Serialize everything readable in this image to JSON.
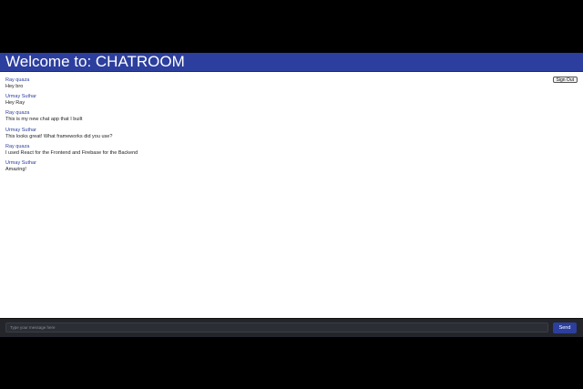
{
  "header": {
    "title": "Welcome to: CHATROOM",
    "background": "#2c3e9e"
  },
  "toolbar": {
    "sign_out_label": "Sign Out"
  },
  "messages": [
    {
      "author": "Ray quaza",
      "text": "Hey bro"
    },
    {
      "author": "Urmay Suthar",
      "text": "Hey Ray"
    },
    {
      "author": "Ray quaza",
      "text": "This is my new chat app that I built"
    },
    {
      "author": "Urmay Suthar",
      "text": "This looks great! What frameworks did you use?"
    },
    {
      "author": "Ray quaza",
      "text": "I used React for the Frontend and Firebase for the Backend"
    },
    {
      "author": "Urmay Suthar",
      "text": "Amazing!"
    }
  ],
  "composer": {
    "placeholder": "Type your message here",
    "value": "",
    "send_label": "Send"
  },
  "colors": {
    "accent": "#2c3e9e",
    "author_name": "#2c3e9e",
    "composer_bg": "#23252b"
  }
}
